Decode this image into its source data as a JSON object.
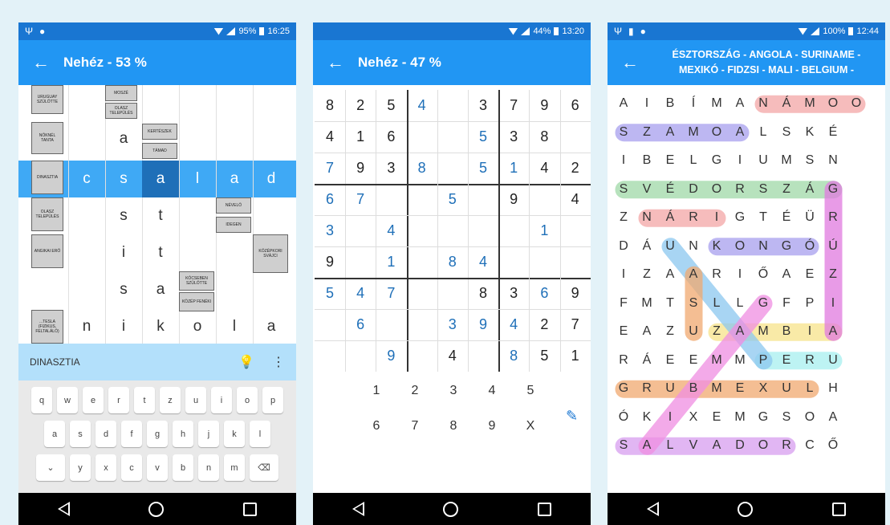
{
  "phones": {
    "crossword": {
      "status_time": "16:25",
      "status_battery": "95%",
      "title": "Nehéz - 53 %",
      "clue_text": "DINASZTIA",
      "word_row": [
        "c",
        "s",
        "a",
        "l",
        "a",
        "d"
      ],
      "clues": [
        "URUGUAY SZÜLÖTTE",
        "MOSZÉ",
        "OLASZ TELEPÜLÉS",
        "NŐKNÉL TANTA",
        "KERTÉSZEK",
        "TÁMAD",
        "DINASZTIA",
        "OLASZ TELEPÜLÉS",
        "NÉVELŐ",
        "IDEGEN",
        "KÖZÉPKORI SVÁJCI",
        "ANGIKAI ERŐ",
        "KÓCSEBEN SZÜLÖTTE",
        "KÖZÉP FENÉKI",
        "...TESLA (FIZIKUS, FELTALÁLÓ)"
      ],
      "letters": {
        "r1": [
          "a"
        ],
        "r3": [
          "s",
          "t"
        ],
        "r4": [
          "i",
          "t"
        ],
        "r5": [
          "s",
          "a"
        ],
        "r6": [
          "n",
          "i",
          "k",
          "o",
          "l",
          "a"
        ]
      },
      "keyboard": [
        [
          "q",
          "w",
          "e",
          "r",
          "t",
          "z",
          "u",
          "i",
          "o",
          "p"
        ],
        [
          "a",
          "s",
          "d",
          "f",
          "g",
          "h",
          "j",
          "k",
          "l"
        ],
        [
          "⌄",
          "y",
          "x",
          "c",
          "v",
          "b",
          "n",
          "m",
          "⌫"
        ]
      ]
    },
    "sudoku": {
      "status_time": "13:20",
      "status_battery": "44%",
      "title": "Nehéz - 47 %",
      "grid": [
        [
          "8",
          "2",
          "5",
          "4",
          "",
          "3",
          "7",
          "9",
          "6"
        ],
        [
          "4",
          "1",
          "6",
          "",
          "",
          "5",
          "3",
          "8",
          ""
        ],
        [
          "7",
          "9",
          "3",
          "8",
          "",
          "5",
          "1",
          "4",
          "2"
        ],
        [
          "6",
          "7",
          "",
          "",
          "5",
          "",
          "9",
          "",
          "4"
        ],
        [
          "3",
          "",
          "4",
          "",
          "",
          "",
          "",
          "1",
          ""
        ],
        [
          "9",
          "",
          "1",
          "",
          "8",
          "4",
          "",
          "",
          ""
        ],
        [
          "5",
          "4",
          "7",
          "",
          "",
          "8",
          "3",
          "6",
          "9"
        ],
        [
          "",
          "6",
          "",
          "",
          "3",
          "9",
          "4",
          "2",
          "7"
        ],
        [
          "",
          "",
          "9",
          "",
          "4",
          "",
          "8",
          "5",
          "1"
        ]
      ],
      "user_cells": [
        [
          0,
          3
        ],
        [
          1,
          5
        ],
        [
          2,
          0
        ],
        [
          2,
          3
        ],
        [
          2,
          5
        ],
        [
          2,
          6
        ],
        [
          3,
          0
        ],
        [
          3,
          1
        ],
        [
          3,
          4
        ],
        [
          4,
          0
        ],
        [
          4,
          2
        ],
        [
          4,
          7
        ],
        [
          5,
          2
        ],
        [
          5,
          4
        ],
        [
          5,
          5
        ],
        [
          6,
          0
        ],
        [
          6,
          1
        ],
        [
          6,
          2
        ],
        [
          6,
          7
        ],
        [
          7,
          1
        ],
        [
          7,
          4
        ],
        [
          7,
          5
        ],
        [
          7,
          6
        ],
        [
          8,
          2
        ],
        [
          8,
          6
        ]
      ],
      "pad": [
        [
          "1",
          "2",
          "3",
          "4",
          "5"
        ],
        [
          "6",
          "7",
          "8",
          "9",
          "X"
        ]
      ]
    },
    "wordsearch": {
      "status_time": "12:44",
      "status_battery": "100%",
      "title_line1": "ÉSZTORSZÁG - ANGOLA - SURINAME -",
      "title_line2": "MEXIKÓ - FIDZSI - MALI - BELGIUM -",
      "grid": [
        [
          "A",
          "I",
          "B",
          "Í",
          "M",
          "A",
          "N",
          "Á",
          "M",
          "O",
          "O"
        ],
        [
          "S",
          "Z",
          "A",
          "M",
          "O",
          "A",
          "L",
          "S",
          "K",
          "É",
          ""
        ],
        [
          "I",
          "B",
          "E",
          "L",
          "G",
          "I",
          "U",
          "M",
          "S",
          "N",
          ""
        ],
        [
          "S",
          "V",
          "É",
          "D",
          "O",
          "R",
          "S",
          "Z",
          "Á",
          "G",
          ""
        ],
        [
          "Z",
          "N",
          "Á",
          "R",
          "I",
          "G",
          "T",
          "É",
          "Ü",
          "R",
          ""
        ],
        [
          "D",
          "Á",
          "U",
          "N",
          "K",
          "O",
          "N",
          "G",
          "Ó",
          "Ú",
          ""
        ],
        [
          "I",
          "Z",
          "A",
          "A",
          "R",
          "I",
          "Ő",
          "A",
          "E",
          "Z",
          ""
        ],
        [
          "F",
          "M",
          "T",
          "S",
          "L",
          "L",
          "G",
          "F",
          "P",
          "I",
          ""
        ],
        [
          "E",
          "A",
          "Z",
          "U",
          "Z",
          "A",
          "M",
          "B",
          "I",
          "A",
          ""
        ],
        [
          "R",
          "Á",
          "E",
          "E",
          "M",
          "M",
          "P",
          "E",
          "R",
          "U",
          ""
        ],
        [
          "G",
          "R",
          "U",
          "B",
          "M",
          "E",
          "X",
          "U",
          "L",
          "H",
          ""
        ],
        [
          "Ó",
          "K",
          "I",
          "X",
          "E",
          "M",
          "G",
          "S",
          "O",
          "A",
          ""
        ],
        [
          "S",
          "A",
          "L",
          "V",
          "A",
          "D",
          "O",
          "R",
          "C",
          "Ő",
          ""
        ]
      ]
    }
  },
  "colors": {
    "statusbar": "#1976d2",
    "appbar": "#2196f3",
    "highlight_row": "#3fa9f5",
    "selected_cell": "#1e6fb8"
  }
}
